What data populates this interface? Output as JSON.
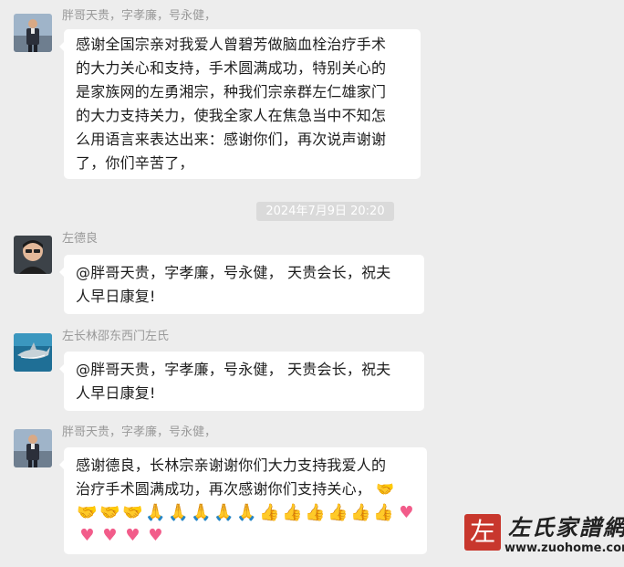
{
  "messages": [
    {
      "sender": "胖哥天贵，字孝廉，号永健，",
      "avatar": "avatar-man-standing",
      "lines": [
        "感谢全国宗亲对我爱人曾碧芳做脑血栓治疗手术",
        "的大力关心和支持，手术圆满成功，特别关心的",
        "是家族网的左勇湘宗，种我们宗亲群左仁雄家门",
        "的大力支持关力，使我全家人在焦急当中不知怎",
        "么用语言来表达出来：感谢你们，再次说声谢谢",
        "了，你们辛苦了，"
      ]
    },
    {
      "sender": "左德良",
      "avatar": "avatar-man-portrait",
      "lines": [
        "@胖哥天贵，字孝廉，号永健，  天贵会长，祝夫",
        "人早日康复!"
      ]
    },
    {
      "sender": "左长林邵东西门左氏",
      "avatar": "avatar-shark",
      "lines": [
        "@胖哥天贵，字孝廉，号永健，  天贵会长，祝夫",
        "人早日康复!"
      ]
    },
    {
      "sender": "胖哥天贵，字孝廉，号永健，",
      "avatar": "avatar-man-standing",
      "lines": [
        "感谢德良，长林宗亲谢谢你们大力支持我爱人的",
        "治疗手术圆满成功，再次感谢你们支持关心，"
      ],
      "emoji_rows": [
        [
          "handshake-emoji",
          "handshake-emoji",
          "handshake-emoji",
          "pray-emoji",
          "pray-emoji",
          "pray-emoji",
          "pray-emoji",
          "pray-emoji",
          "thumbs-up-emoji",
          "thumbs-up-emoji",
          "thumbs-up-emoji",
          "thumbs-up-emoji",
          "thumbs-up-emoji",
          "thumbs-up-emoji",
          "heart-emoji"
        ],
        [
          "heart-emoji",
          "heart-emoji",
          "heart-emoji",
          "heart-emoji"
        ]
      ],
      "trailing_emoji": "handshake-emoji"
    }
  ],
  "timestamp": "2024年7月9日 20:20",
  "watermark": {
    "seal_char": "左",
    "title": "左氏家譜網",
    "url": "www.zuohome.com"
  },
  "colors": {
    "background": "#ededed",
    "bubble": "#ffffff",
    "sender_name": "#9a9a9a",
    "timestamp_bg": "#dadada",
    "seal_red": "#c8372d"
  }
}
